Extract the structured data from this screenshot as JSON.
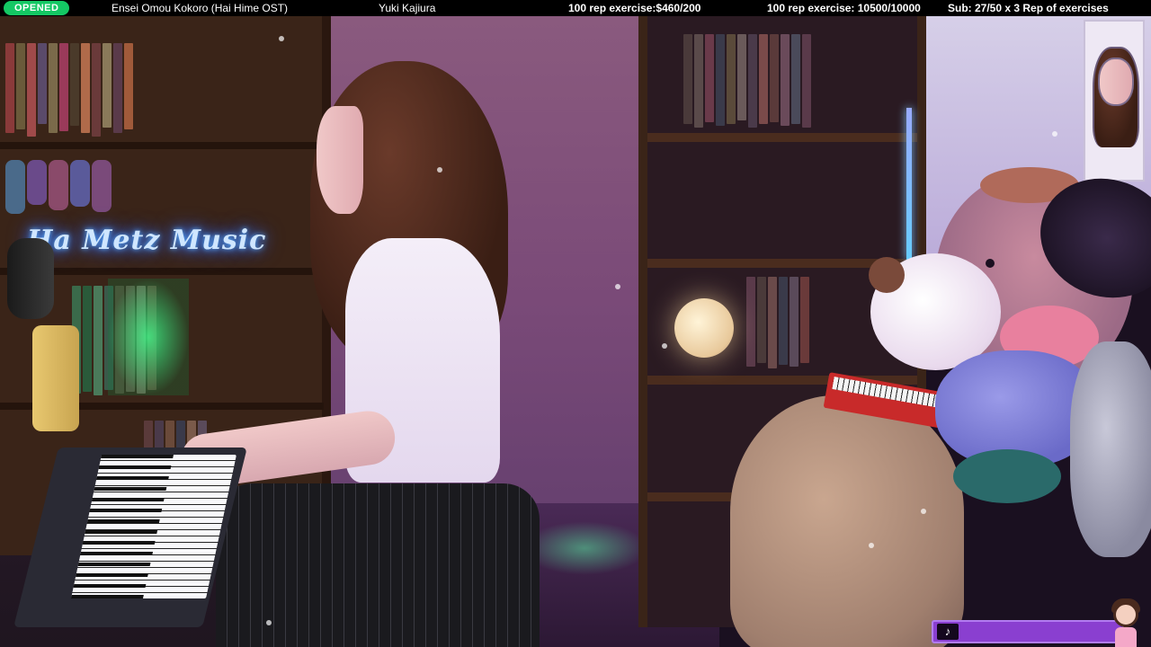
{
  "overlay": {
    "status_badge": "OPENED",
    "song_title": "Ensei Omou Kokoro (Hai Hime OST)",
    "composer": "Yuki Kajiura",
    "donation_goal": "100 rep exercise:$460/200",
    "rep_goal": "100 rep exercise: 10500/10000",
    "sub_goal": "Sub: 27/50 x 3 Rep of exercises"
  },
  "scene": {
    "neon_sign_text": "Ha Metz Music",
    "neon_sign_color": "#5ab0ff",
    "accent_green": "#14c864",
    "accent_purple": "#8a3fd0"
  },
  "widget": {
    "icon": "tiktok-icon",
    "glyph": "♪"
  }
}
